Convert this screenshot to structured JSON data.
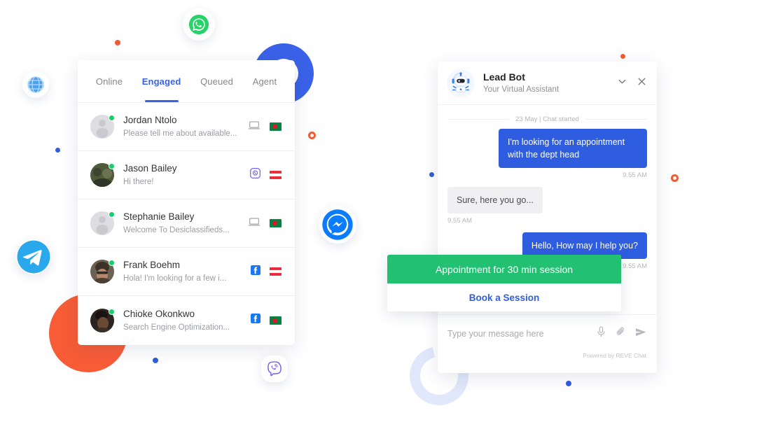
{
  "chat_list": {
    "tabs": [
      {
        "label": "Online",
        "active": false
      },
      {
        "label": "Engaged",
        "active": true
      },
      {
        "label": "Queued",
        "active": false
      },
      {
        "label": "Agent",
        "active": false
      }
    ],
    "rows": [
      {
        "name": "Jordan Ntolo",
        "message": "Please tell me about available...",
        "avatar": "placeholder-avatar",
        "status": "online",
        "channel_icon": "laptop-icon",
        "flag": "bangladesh-flag"
      },
      {
        "name": "Jason Bailey",
        "message": "Hi there!",
        "avatar": "photo-avatar",
        "status": "online",
        "channel_icon": "viber-icon",
        "flag": "austria-flag"
      },
      {
        "name": "Stephanie Bailey",
        "message": "Welcome To Desiclassifieds...",
        "avatar": "placeholder-avatar",
        "status": "online",
        "channel_icon": "laptop-icon",
        "flag": "bangladesh-flag"
      },
      {
        "name": "Frank Boehm",
        "message": "Hola! I'm looking for a few i...",
        "avatar": "photo-avatar",
        "status": "online",
        "channel_icon": "facebook-icon",
        "flag": "austria-flag"
      },
      {
        "name": "Chioke Okonkwo",
        "message": "Search Engine Optimization...",
        "avatar": "photo-avatar",
        "status": "online",
        "channel_icon": "facebook-icon",
        "flag": "bangladesh-flag"
      }
    ]
  },
  "bot_widget": {
    "title": "Lead Bot",
    "subtitle": "Your Virtual Assistant",
    "avatar_icon": "robot-avatar-icon",
    "minimize_icon": "chevron-down-icon",
    "close_icon": "close-icon",
    "date_separator": "23 May | Chat started",
    "messages": [
      {
        "direction": "out",
        "text": "I'm looking for an appointment with the dept head",
        "time": "9.55 AM"
      },
      {
        "direction": "in",
        "text": "Sure, here you go...",
        "time": "9.55 AM"
      },
      {
        "direction": "out",
        "text": "Hello, How may I help you?",
        "time": "9.55 AM"
      }
    ],
    "appointment_card": {
      "title": "Appointment for 30 min session",
      "action_label": "Book a Session",
      "header_color": "#22c172",
      "action_color": "#2f5de0"
    },
    "composer": {
      "placeholder": "Type your message here",
      "mic_icon": "microphone-icon",
      "attach_icon": "paperclip-icon",
      "send_icon": "send-icon"
    },
    "powered_by": "Powered by REVE Chat"
  },
  "decorations": {
    "badges": [
      {
        "name": "whatsapp-badge",
        "color": "#25d366"
      },
      {
        "name": "messenger-badge",
        "color": "#0a7cff"
      },
      {
        "name": "telegram-badge",
        "color": "#29a9eb"
      },
      {
        "name": "viber-badge",
        "color": "#7360f2"
      },
      {
        "name": "globe-badge",
        "color": "#4ba3ec"
      }
    ],
    "shapes": [
      {
        "name": "blue-arc",
        "color": "#3a62e8"
      },
      {
        "name": "orange-circle",
        "color": "#f85c37"
      },
      {
        "name": "lightblue-arc",
        "color": "#e2e8fb"
      }
    ],
    "dots": [
      {
        "name": "orange-dot",
        "color": "#f25c34"
      },
      {
        "name": "blue-dot",
        "color": "#2f5de0"
      },
      {
        "name": "orange-ring",
        "color": "#f25c34"
      }
    ]
  }
}
